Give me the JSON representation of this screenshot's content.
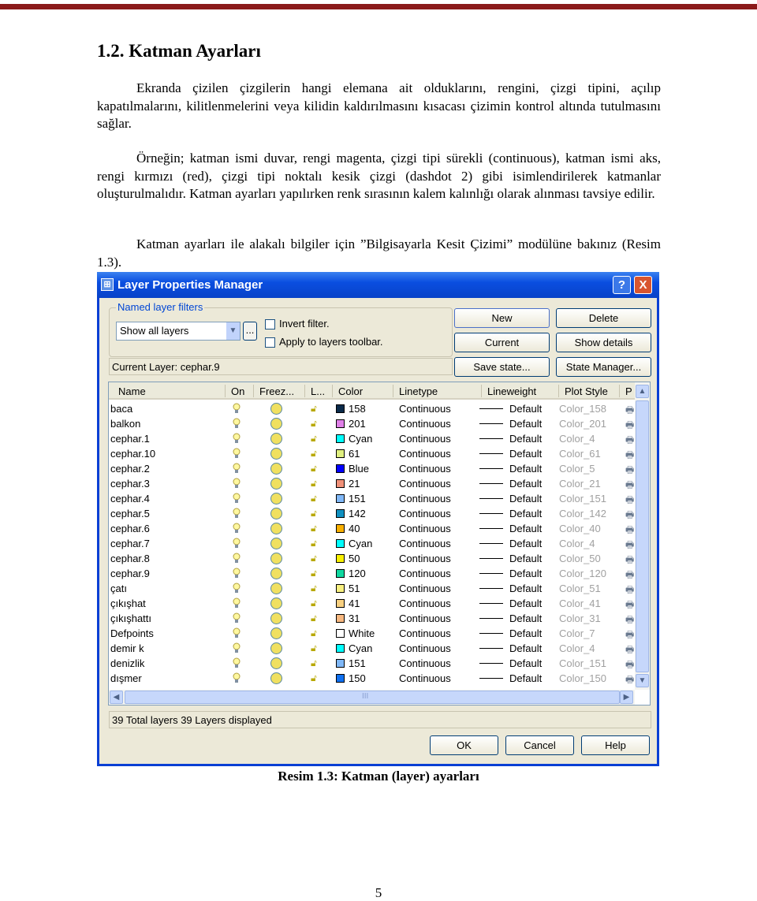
{
  "heading": "1.2. Katman Ayarları",
  "paragraphs": [
    "Ekranda çizilen çizgilerin hangi elemana ait olduklarını, rengini, çizgi tipini, açılıp kapatılmalarını, kilitlenmelerini veya kilidin kaldırılmasını kısacası çizimin kontrol altında tutulmasını sağlar.",
    "Örneğin; katman ismi duvar, rengi magenta, çizgi tipi sürekli (continuous), katman ismi aks, rengi kırmızı (red), çizgi tipi noktalı kesik çizgi (dashdot 2) gibi isimlendirilerek katmanlar oluşturulmalıdır. Katman ayarları yapılırken renk sırasının kalem kalınlığı olarak alınması tavsiye edilir.",
    "Katman ayarları ile alakalı bilgiler için ”Bilgisayarla Kesit Çizimi” modülüne bakınız (Resim 1.3)."
  ],
  "dialog": {
    "title": "Layer Properties Manager",
    "help": "?",
    "close": "X",
    "filters_label": "Named layer filters",
    "filter_value": "Show all layers",
    "dots": "...",
    "invert_filter": "Invert filter.",
    "apply_toolbar": "Apply to layers toolbar.",
    "buttons": {
      "new": "New",
      "delete": "Delete",
      "current": "Current",
      "show_details": "Show details",
      "save_state": "Save state...",
      "state_manager": "State Manager...",
      "ok": "OK",
      "cancel": "Cancel",
      "help": "Help"
    },
    "current_layer": "Current Layer:  cephar.9",
    "columns": [
      "Name",
      "On",
      "Freez...",
      "L...",
      "Color",
      "Linetype",
      "Lineweight",
      "Plot Style",
      "P"
    ],
    "rows": [
      {
        "name": "baca",
        "color": "158",
        "hex": "#0a2a4a",
        "linetype": "Continuous",
        "lineweight": "Default",
        "plot": "Color_158"
      },
      {
        "name": "balkon",
        "color": "201",
        "hex": "#e080e8",
        "linetype": "Continuous",
        "lineweight": "Default",
        "plot": "Color_201"
      },
      {
        "name": "cephar.1",
        "color": "Cyan",
        "hex": "#00ffff",
        "linetype": "Continuous",
        "lineweight": "Default",
        "plot": "Color_4"
      },
      {
        "name": "cephar.10",
        "color": "61",
        "hex": "#e0f080",
        "linetype": "Continuous",
        "lineweight": "Default",
        "plot": "Color_61"
      },
      {
        "name": "cephar.2",
        "color": "Blue",
        "hex": "#0000ff",
        "linetype": "Continuous",
        "lineweight": "Default",
        "plot": "Color_5"
      },
      {
        "name": "cephar.3",
        "color": "21",
        "hex": "#f09078",
        "linetype": "Continuous",
        "lineweight": "Default",
        "plot": "Color_21"
      },
      {
        "name": "cephar.4",
        "color": "151",
        "hex": "#80b8f8",
        "linetype": "Continuous",
        "lineweight": "Default",
        "plot": "Color_151"
      },
      {
        "name": "cephar.5",
        "color": "142",
        "hex": "#1090c0",
        "linetype": "Continuous",
        "lineweight": "Default",
        "plot": "Color_142"
      },
      {
        "name": "cephar.6",
        "color": "40",
        "hex": "#f8b000",
        "linetype": "Continuous",
        "lineweight": "Default",
        "plot": "Color_40"
      },
      {
        "name": "cephar.7",
        "color": "Cyan",
        "hex": "#00ffff",
        "linetype": "Continuous",
        "lineweight": "Default",
        "plot": "Color_4"
      },
      {
        "name": "cephar.8",
        "color": "50",
        "hex": "#f8f000",
        "linetype": "Continuous",
        "lineweight": "Default",
        "plot": "Color_50"
      },
      {
        "name": "cephar.9",
        "color": "120",
        "hex": "#10d8a0",
        "linetype": "Continuous",
        "lineweight": "Default",
        "plot": "Color_120"
      },
      {
        "name": "çatı",
        "color": "51",
        "hex": "#f8f080",
        "linetype": "Continuous",
        "lineweight": "Default",
        "plot": "Color_51"
      },
      {
        "name": "çıkışhat",
        "color": "41",
        "hex": "#f8d080",
        "linetype": "Continuous",
        "lineweight": "Default",
        "plot": "Color_41"
      },
      {
        "name": "çıkışhattı",
        "color": "31",
        "hex": "#f8b880",
        "linetype": "Continuous",
        "lineweight": "Default",
        "plot": "Color_31"
      },
      {
        "name": "Defpoints",
        "color": "White",
        "hex": "#ffffff",
        "linetype": "Continuous",
        "lineweight": "Default",
        "plot": "Color_7"
      },
      {
        "name": "demir k",
        "color": "Cyan",
        "hex": "#00ffff",
        "linetype": "Continuous",
        "lineweight": "Default",
        "plot": "Color_4"
      },
      {
        "name": "denizlik",
        "color": "151",
        "hex": "#80b8f8",
        "linetype": "Continuous",
        "lineweight": "Default",
        "plot": "Color_151"
      },
      {
        "name": "dışmer",
        "color": "150",
        "hex": "#1070f0",
        "linetype": "Continuous",
        "lineweight": "Default",
        "plot": "Color_150"
      }
    ],
    "status": "39 Total layers    39 Layers displayed",
    "scroll_grip": "III"
  },
  "caption": "Resim 1.3: Katman (layer) ayarları",
  "page_number": "5"
}
